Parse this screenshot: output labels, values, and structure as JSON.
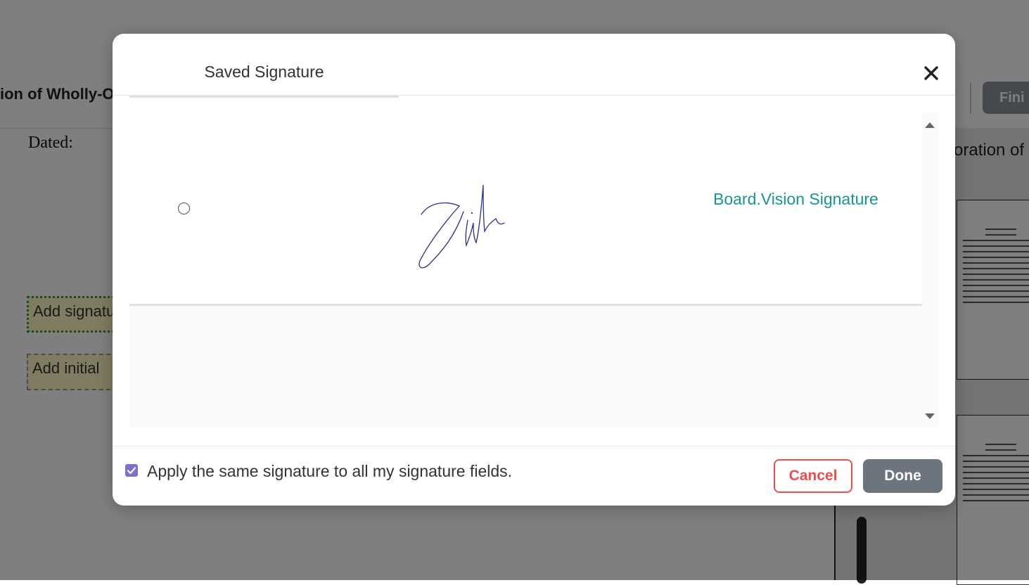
{
  "background": {
    "document_title": "ion of Wholly-Ow",
    "finish_button": "Fini",
    "dated_label": "Dated:",
    "add_signature_field": "Add signatur",
    "add_initial_field": "Add initial",
    "right_panel_title": "oration of"
  },
  "modal": {
    "tab_label": "Saved Signature",
    "close_icon": "close-icon",
    "signature_option": {
      "type_label": "Board.Vision Signature",
      "selected": false
    },
    "apply_all": {
      "checked": true,
      "label": "Apply the same signature to all my signature fields."
    },
    "cancel_label": "Cancel",
    "done_label": "Done"
  },
  "colors": {
    "signature_type_text": "#17958e",
    "cancel_accent": "#f04e4e",
    "done_background": "#6c757d",
    "checkbox": "#7e72c8",
    "signature_ink": "#2a2f8f"
  }
}
